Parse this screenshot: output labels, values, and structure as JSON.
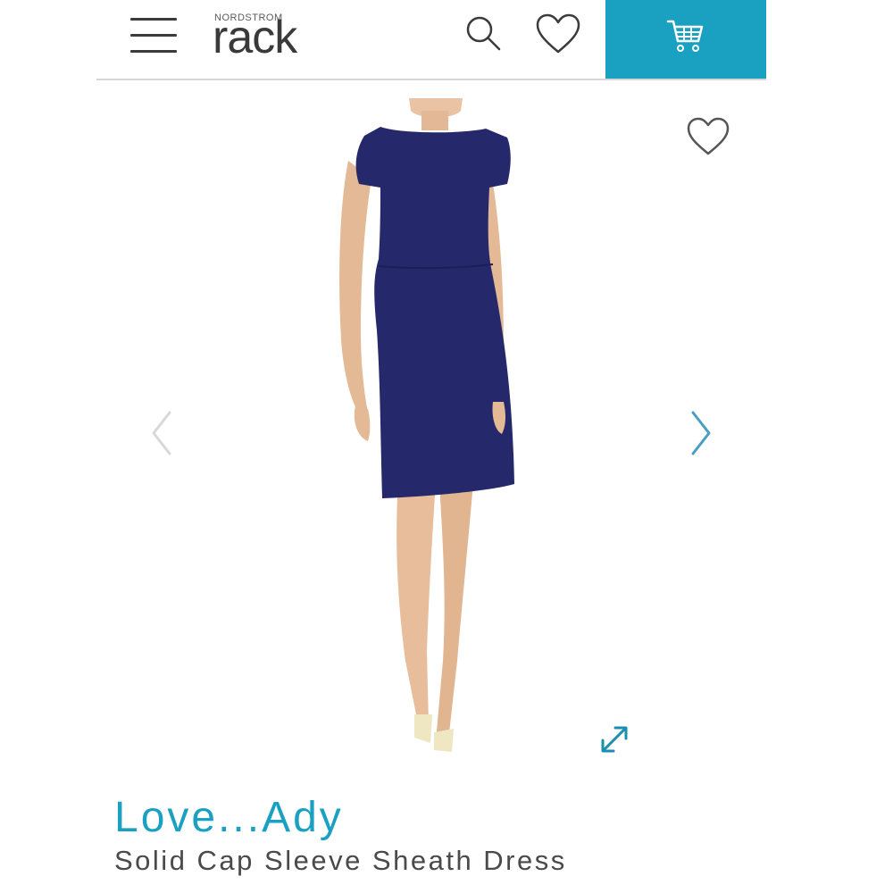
{
  "header": {
    "menu_icon": "hamburger-menu-icon",
    "logo_small": "NORDSTROM",
    "logo_big": "rack",
    "search_icon": "search-icon",
    "wishlist_icon": "heart-icon",
    "cart_icon": "cart-icon"
  },
  "colors": {
    "accent": "#1aa1c2",
    "text_dark": "#4a4a4a",
    "dress_navy": "#25286b"
  },
  "product_image": {
    "favorite_icon": "heart-outline-icon",
    "prev_icon": "chevron-left-icon",
    "next_icon": "chevron-right-icon",
    "expand_icon": "expand-arrows-icon"
  },
  "product": {
    "brand": "Love...Ady",
    "name": "Solid Cap Sleeve Sheath Dress"
  }
}
